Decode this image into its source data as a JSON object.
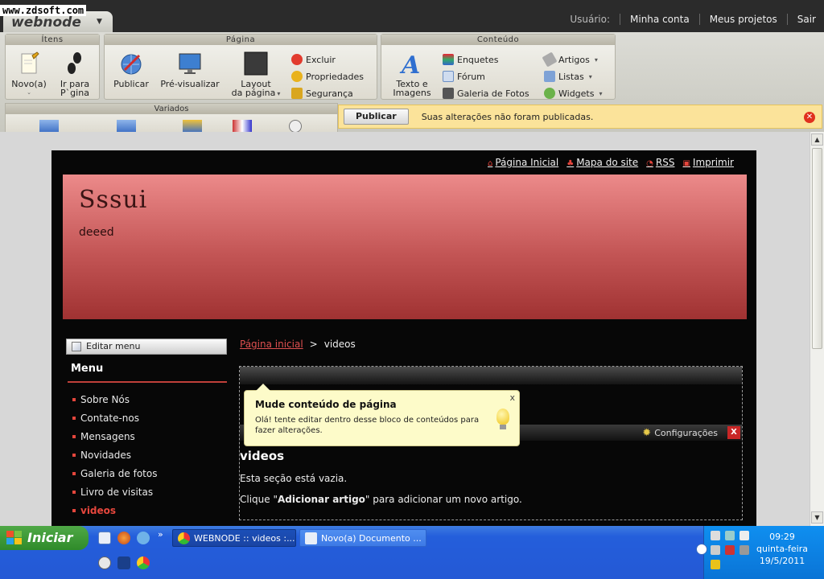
{
  "watermark": "www.zdsoft.com",
  "app": {
    "logo": "webnode",
    "user_nav": {
      "label": "Usuário:",
      "links": [
        "Minha conta",
        "Meus projetos",
        "Sair"
      ]
    }
  },
  "ribbon": {
    "groups": {
      "itens": "Ítens",
      "pagina": "Página",
      "conteudo": "Conteúdo",
      "variados": "Variados"
    },
    "itens": {
      "novo": "Novo(a)",
      "ir_para_1": "Ir para",
      "ir_para_2": "P`gina"
    },
    "pagina": {
      "publicar": "Publicar",
      "pre_visualizar": "Pré-visualizar",
      "layout_1": "Layout",
      "layout_2": "da página",
      "excluir": "Excluir",
      "propriedades": "Propriedades",
      "seguranca": "Segurança"
    },
    "conteudo": {
      "texto_1": "Texto e",
      "texto_2": "Imagens",
      "enquetes": "Enquetes",
      "forum": "Fórum",
      "galeria": "Galeria de Fotos",
      "artigos": "Artigos",
      "listas": "Listas",
      "widgets": "Widgets"
    },
    "icons": {
      "novo": "new-document-icon",
      "ir_para": "footprints-icon",
      "publicar": "globe-publish-icon",
      "pre_visualizar": "monitor-preview-icon",
      "layout": "layout-icon",
      "excluir": "delete-icon",
      "propriedades": "properties-icon",
      "seguranca": "lock-icon",
      "texto": "text-image-icon",
      "enquetes": "poll-icon",
      "forum": "forum-icon",
      "galeria": "photo-gallery-icon",
      "artigos": "articles-icon",
      "listas": "lists-icon",
      "widgets": "widgets-icon"
    }
  },
  "notice": {
    "button": "Publicar",
    "text": "Suas alterações não foram publicadas."
  },
  "site": {
    "top_links": [
      "Página Inicial",
      "Mapa do site",
      "RSS",
      "Imprimir"
    ],
    "title": "Sssui",
    "subtitle": "deeed",
    "edit_menu": "Editar menu",
    "menu_title": "Menu",
    "menu_items": [
      "Sobre Nós",
      "Contate-nos",
      "Mensagens",
      "Novidades",
      "Galeria de fotos",
      "Livro de visitas",
      "videos"
    ],
    "active_menu_index": 6,
    "breadcrumb": {
      "home": "Página inicial",
      "separator": ">",
      "current": "videos"
    },
    "tooltip": {
      "title": "Mude conteúdo de página",
      "body": "Olá! tente editar dentro desse bloco de conteúdos para fazer alterações.",
      "close": "x"
    },
    "config": {
      "label": "Configurações",
      "close": "X"
    },
    "section": {
      "title": "videos",
      "empty": "Esta seção está vazia.",
      "hint_pre": "Clique \"",
      "hint_bold": "Adicionar artigo",
      "hint_post": "\" para adicionar um novo artigo."
    }
  },
  "taskbar": {
    "start": "Iniciar",
    "tasks": [
      "WEBNODE :: videos :...",
      "Novo(a) Documento ..."
    ],
    "clock": {
      "time": "09:29",
      "day": "quinta-feira",
      "date": "19/5/2011"
    }
  },
  "colors": {
    "accent_red": "#e4463c",
    "banner_top": "#ec8a8a",
    "banner_bottom": "#a03232",
    "notice_bg": "#fbe39a",
    "tooltip_bg": "#fdfbc9"
  }
}
